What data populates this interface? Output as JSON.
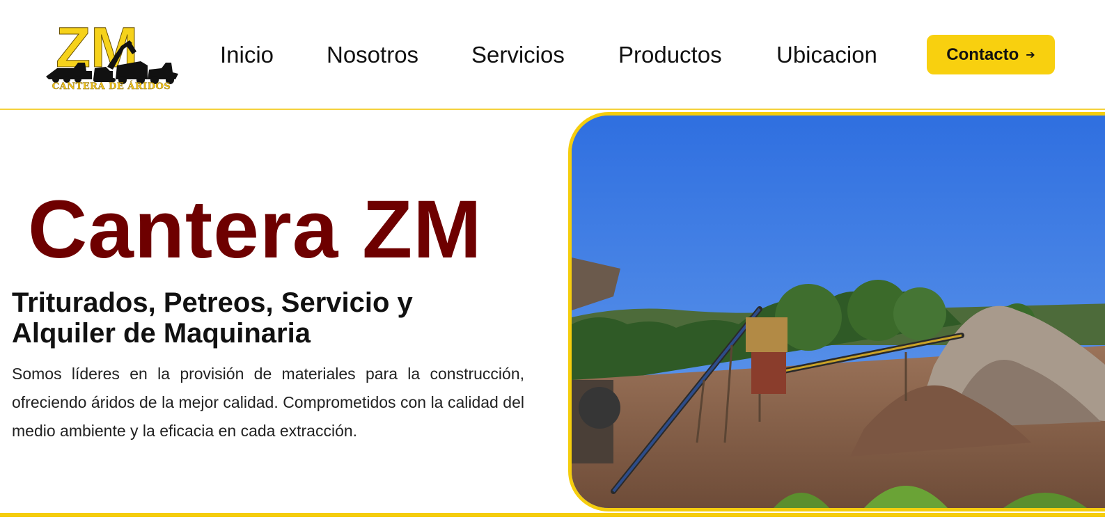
{
  "brand": {
    "logo_letters": "ZM",
    "logo_caption": "CANTERA DE ÁRIDOS",
    "accent_color": "#f8d00f",
    "title_color": "#6e0000"
  },
  "nav": {
    "items": [
      {
        "label": "Inicio"
      },
      {
        "label": "Nosotros"
      },
      {
        "label": "Servicios"
      },
      {
        "label": "Productos"
      },
      {
        "label": "Ubicacion"
      }
    ],
    "cta_label": "Contacto",
    "cta_icon": "arrow-right-icon"
  },
  "hero": {
    "title": "Cantera ZM",
    "subtitle": "Triturados, Petreos, Servicio y Alquiler de Maquinaria",
    "body": "Somos líderes en la provisión de materiales para la construcción, ofreciendo áridos de la mejor calidad. Comprometidos con la calidad del medio ambiente y la eficacia en cada extracción.",
    "image": "quarry-conveyor-photo"
  }
}
